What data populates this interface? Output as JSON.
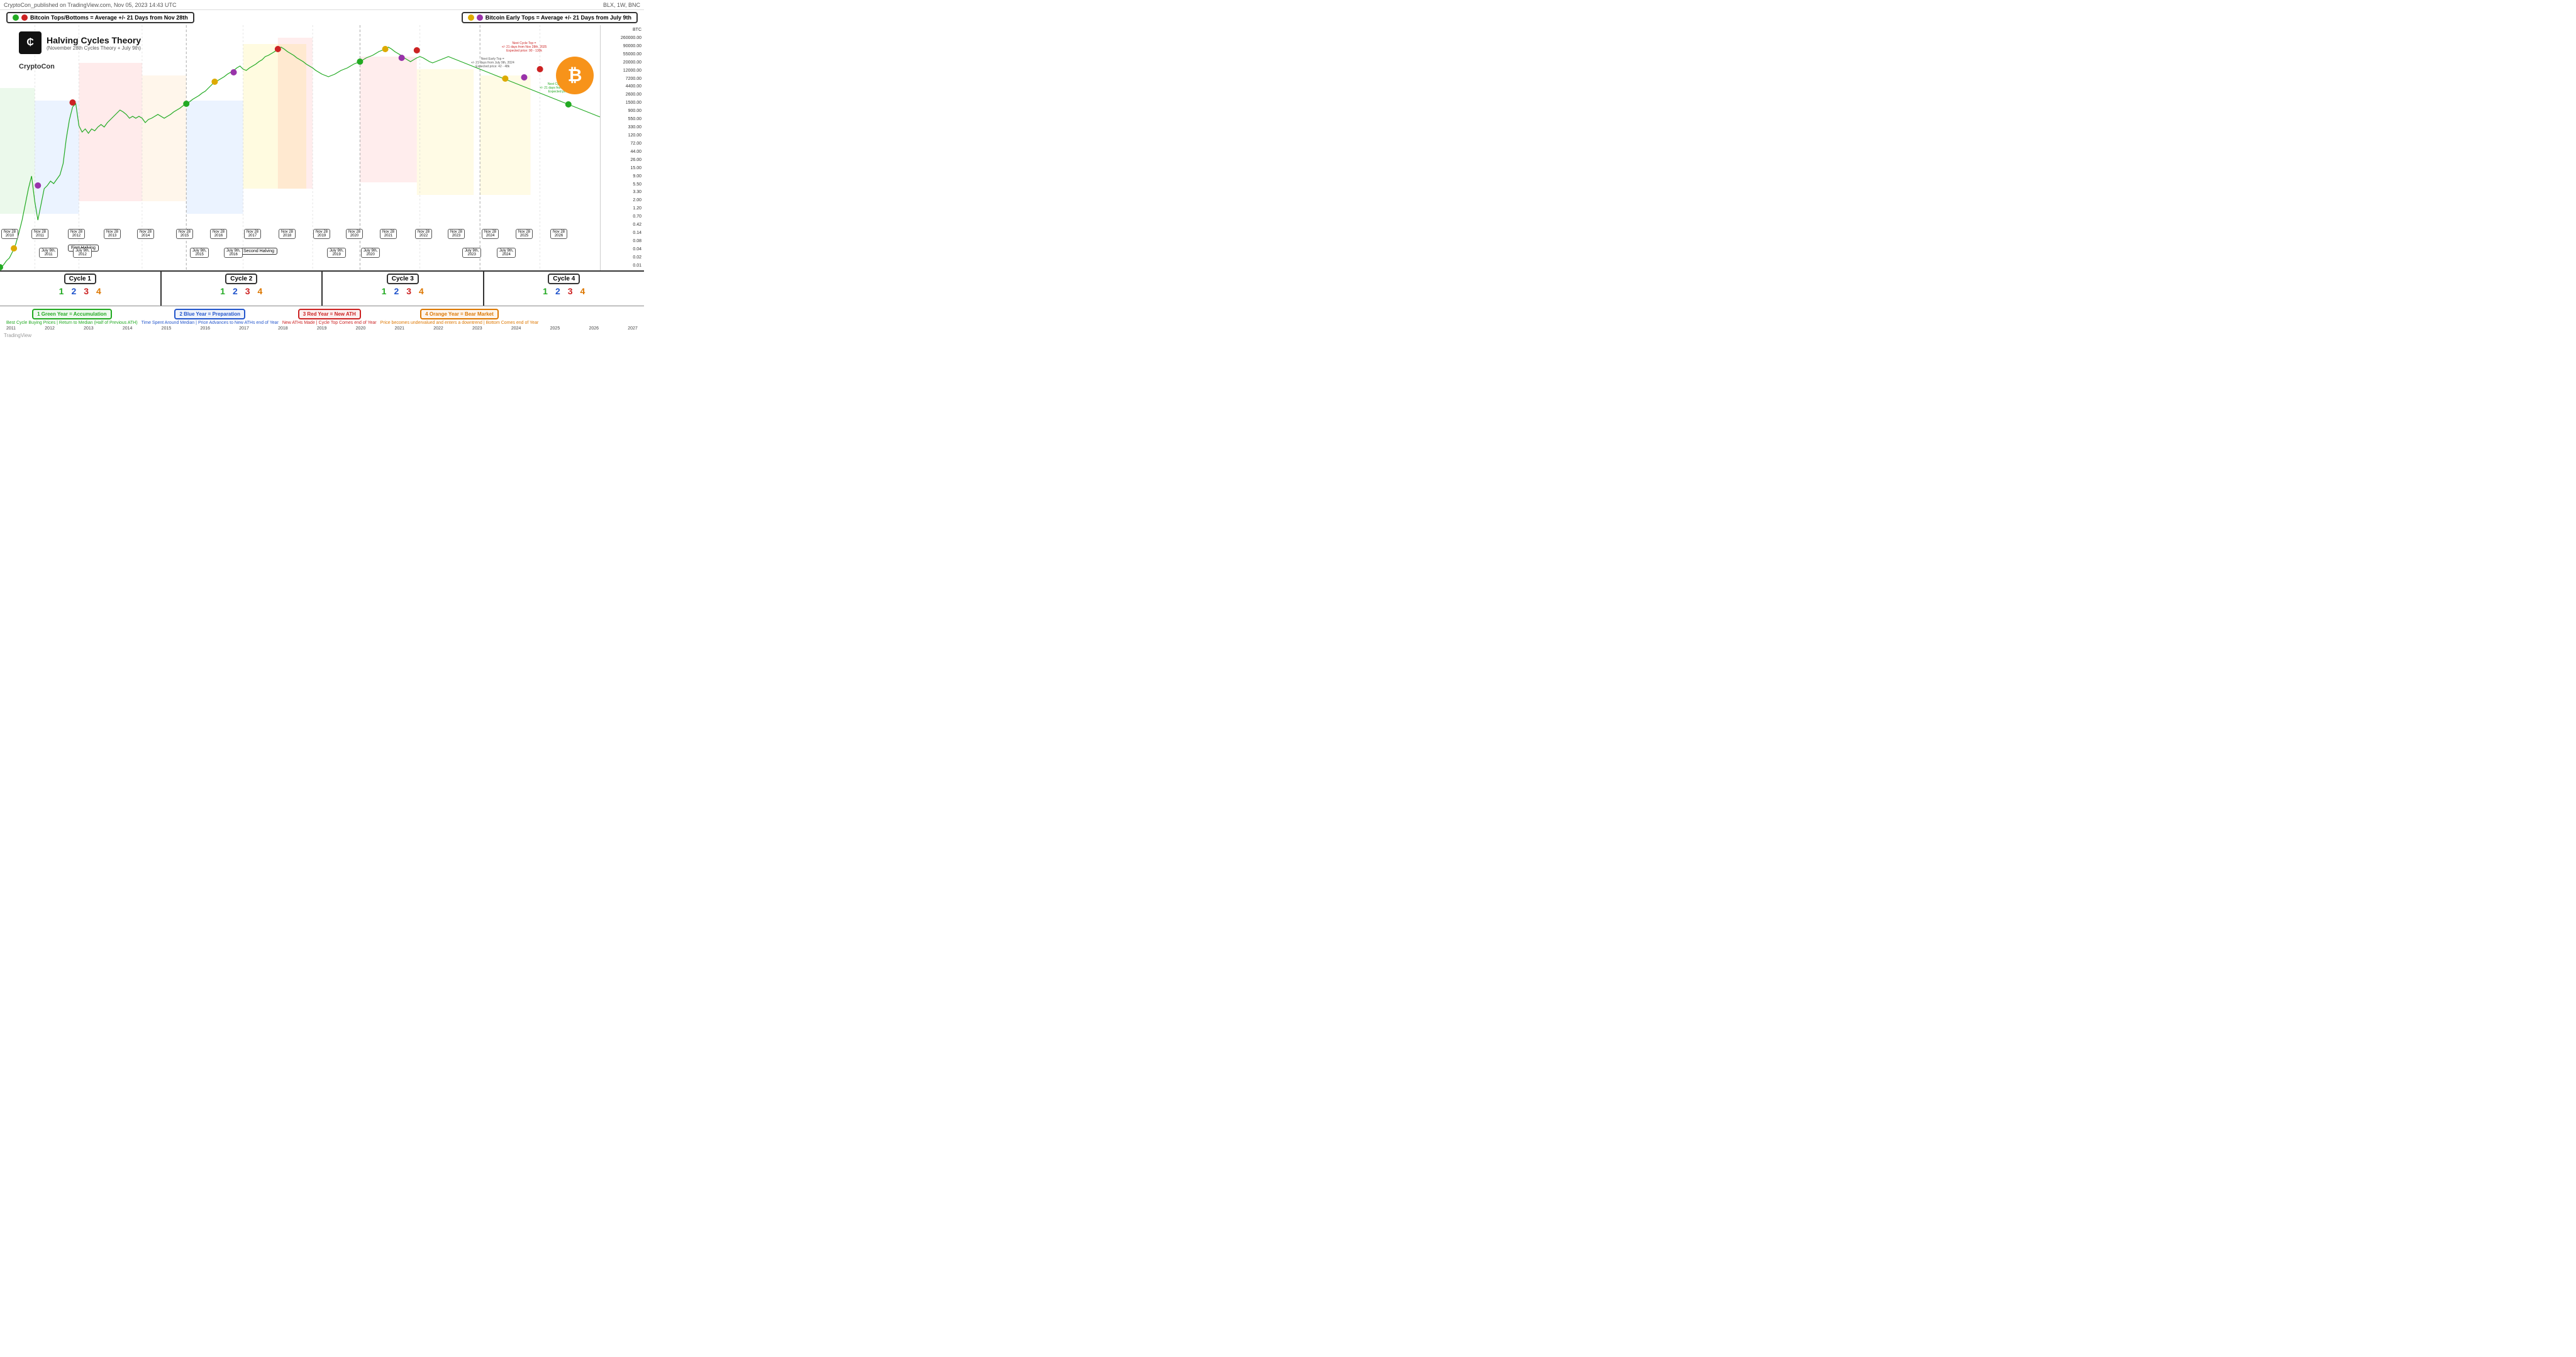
{
  "header": {
    "published": "CryptoCon_published on TradingView.com, Nov 05, 2023 14:43 UTC",
    "ticker": "BLX, 1W, BNC"
  },
  "legend_left": {
    "label": "Bitcoin Tops/Bottoms = Average +/- 21 Days from Nov 28th",
    "dot1": "green",
    "dot2": "red"
  },
  "legend_right": {
    "label": "Bitcoin  Early Tops = Average +/- 21 Days from July 9th",
    "dot1": "yellow",
    "dot2": "purple"
  },
  "chart_title": "Halving Cycles Theory",
  "chart_subtitle": "(November 28th Cycles Theory + July 9th)",
  "author": "CryptoCon",
  "price_levels": [
    "260000.00",
    "90000.00",
    "55000.00",
    "20000.00",
    "12000.00",
    "7200.00",
    "4400.00",
    "2600.00",
    "1500.00",
    "900.00",
    "550.00",
    "330.00",
    "120.00",
    "72.00",
    "44.00",
    "26.00",
    "15.00",
    "9.00",
    "5.50",
    "3.30",
    "2.00",
    "1.20",
    "0.70",
    "0.42",
    "0.14",
    "0.08",
    "0.04",
    "0.02",
    "0.01"
  ],
  "cycles": [
    {
      "label": "Cycle 1",
      "numbers": [
        "1",
        "2",
        "3",
        "4"
      ]
    },
    {
      "label": "Cycle 2",
      "numbers": [
        "1",
        "2",
        "3",
        "4"
      ]
    },
    {
      "label": "Cycle 3",
      "numbers": [
        "1",
        "2",
        "3",
        "4"
      ]
    },
    {
      "label": "Cycle 4",
      "numbers": [
        "1",
        "2",
        "3",
        "4"
      ]
    }
  ],
  "year_labels": [
    {
      "num": "1",
      "text": "Green Year = Accumulation",
      "class": "green",
      "desc": "Best Cycle Buying Prices | Return to Median (Half of Previous ATH)"
    },
    {
      "num": "2",
      "text": "Blue Year = Preparation",
      "class": "blue",
      "desc": "Time Spent Around Median | Price Advances to New ATHs end of Year"
    },
    {
      "num": "3",
      "text": "Red Year = New ATH",
      "class": "red",
      "desc": "New ATHs Made | Cycle Top Comes end of Year"
    },
    {
      "num": "4",
      "text": "Orange Year = Bear Market",
      "class": "orange",
      "desc": "Price becomes undervalued and enters a downtrend | Bottom Comes end of Year"
    }
  ],
  "date_labels": [
    "Nov 28\n2010",
    "Nov 28\n2011",
    "Nov 28\n2012",
    "Nov 28\n2013",
    "Nov 28\n2014",
    "Nov 28\n2015",
    "Nov 28\n2016",
    "Nov 28\n2017",
    "Nov 28\n2018",
    "Nov 28\n2019",
    "Nov 28\n2020",
    "Nov 28\n2021",
    "Nov 28\n2022",
    "Nov 28\n2023",
    "Nov 28\n2024",
    "Nov 28\n2025",
    "Nov 28\n2026"
  ],
  "july_dates": [
    "July 9th,\n2011",
    "July 9th,\n2012",
    "July 9th,\n2015",
    "July 9th,\n2016",
    "July 9th,\n2019",
    "July 9th,\n2020",
    "July 9th,\n2023",
    "July 9th,\n2024"
  ],
  "halving_labels": [
    "First Halving",
    "Second Halving"
  ],
  "year_axis": [
    "2011",
    "2012",
    "2013",
    "2014",
    "2015",
    "2016",
    "2017",
    "2018",
    "2019",
    "2020",
    "2021",
    "2022",
    "2023",
    "2024",
    "2025",
    "2026",
    "2027"
  ],
  "annotations": {
    "next_cycle_top": "Next Cycle Top =\n+/- 21 days from Nov 28th, 2025\nExpected price: 90 - 130k",
    "next_early_top": "Next Early Top =\n+/- 21 days from July 9th, 2024\nExpected price: 42 - 48k",
    "next_cycle_bottom": "Next Cycle Bottom =\n+/- 21 days from Nov 28th, 2026\nExpected price: 27k"
  },
  "tradingview": "TradingView"
}
